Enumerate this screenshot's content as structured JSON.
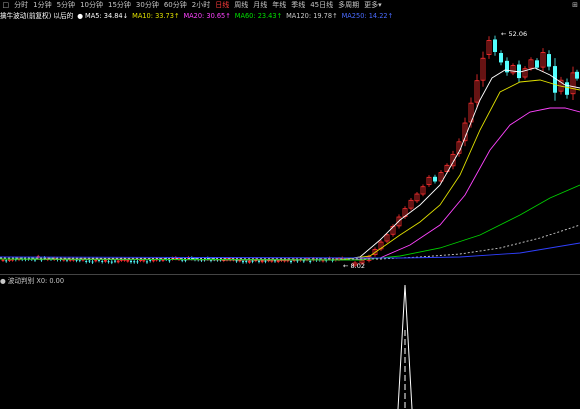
{
  "toolbar": {
    "menu_icon": "□",
    "periods": [
      {
        "label": "分时",
        "state": "normal"
      },
      {
        "label": "1分钟",
        "state": "normal"
      },
      {
        "label": "5分钟",
        "state": "normal"
      },
      {
        "label": "10分钟",
        "state": "normal"
      },
      {
        "label": "15分钟",
        "state": "normal"
      },
      {
        "label": "30分钟",
        "state": "normal"
      },
      {
        "label": "60分钟",
        "state": "normal"
      },
      {
        "label": "2小时",
        "state": "normal"
      },
      {
        "label": "日线",
        "state": "hl"
      },
      {
        "label": "周线",
        "state": "normal"
      },
      {
        "label": "月线",
        "state": "normal"
      },
      {
        "label": "年线",
        "state": "normal"
      },
      {
        "label": "季线",
        "state": "normal"
      },
      {
        "label": "45日线",
        "state": "normal"
      },
      {
        "label": "多周期",
        "state": "normal"
      },
      {
        "label": "更多▾",
        "state": "normal"
      }
    ],
    "right_icon": "⊞"
  },
  "legend": {
    "title": "擒牛波动(前复权) 以后的",
    "items": [
      {
        "text": "● MA5: 34.84↓",
        "color": "#ffffff"
      },
      {
        "text": "MA10: 33.73↑",
        "color": "#e0e000"
      },
      {
        "text": "MA20: 30.65↑",
        "color": "#ff44ff"
      },
      {
        "text": "MA60: 23.43↑",
        "color": "#00e000"
      },
      {
        "text": "MA120: 19.78↑",
        "color": "#c8c8c8"
      },
      {
        "text": "MA250: 14.22↑",
        "color": "#4a6bff"
      }
    ]
  },
  "chart_annotations": {
    "high_label": "← 52.06",
    "low_label": "← 8.02"
  },
  "sub_legend": {
    "title": "● 波动判别 X0: 0.00",
    "color": "#c8c8c8"
  },
  "colors": {
    "up": "#ff3030",
    "down": "#54ffff",
    "ma5": "#ffffff",
    "ma10": "#e0e000",
    "ma20": "#ff44ff",
    "ma60": "#00d000",
    "ma120": "#d0d0d0",
    "ma250": "#3040ff"
  },
  "chart_data": {
    "type": "candlestick",
    "high": 52.06,
    "low": 8.02,
    "ma_series": [
      "MA5",
      "MA10",
      "MA20",
      "MA60",
      "MA120",
      "MA250"
    ]
  }
}
